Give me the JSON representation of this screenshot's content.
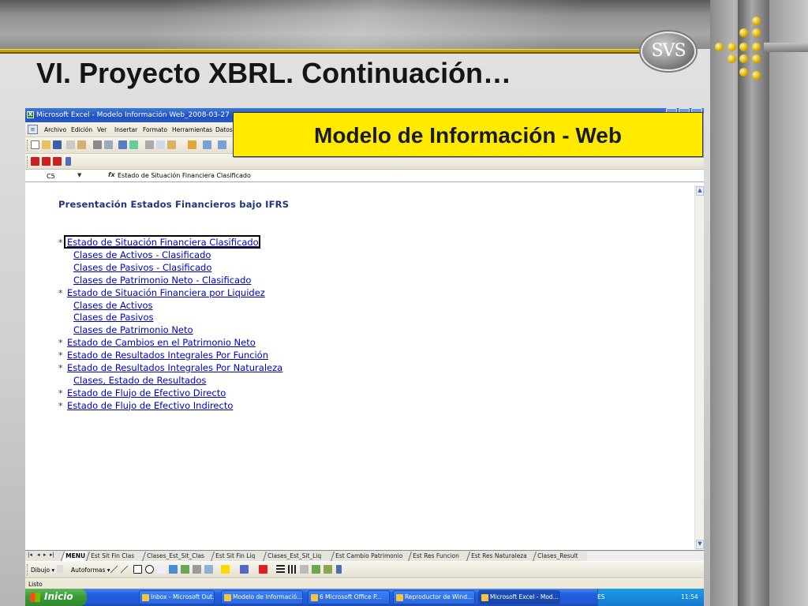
{
  "slide": {
    "title": "VI. Proyecto XBRL. Continuación…",
    "logo_text": "SVS",
    "callout_text": "Modelo de Información - Web"
  },
  "excel": {
    "window_title": "Microsoft Excel - Modelo Información Web_2008-03-27",
    "menu": [
      "Archivo",
      "Edición",
      "Ver",
      "Insertar",
      "Formato",
      "Herramientas",
      "Datos"
    ],
    "name_box": "C5",
    "fx_label": "fx",
    "formula": "Estado de Situación Financiera Clasificado",
    "sheet": {
      "heading": "Presentación Estados Financieros bajo IFRS",
      "items": [
        {
          "label": "Estado de Situación Financiera Clasificado",
          "level": 0,
          "star": "*"
        },
        {
          "label": "Clases de Activos - Clasificado",
          "level": 1
        },
        {
          "label": "Clases de Pasivos - Clasificado",
          "level": 1
        },
        {
          "label": "Clases de Patrimonio Neto - Clasificado",
          "level": 1
        },
        {
          "label": "Estado de Situación Financiera por Liquidez",
          "level": 0,
          "star": "*"
        },
        {
          "label": "Clases de Activos",
          "level": 1
        },
        {
          "label": "Clases de Pasivos",
          "level": 1
        },
        {
          "label": "Clases de Patrimonio Neto",
          "level": 1
        },
        {
          "label": "Estado de Cambios en el Patrimonio Neto",
          "level": 0,
          "star": "*"
        },
        {
          "label": "Estado de Resultados Integrales Por Función",
          "level": 0,
          "star": "*"
        },
        {
          "label": "Estado de Resultados Integrales Por Naturaleza",
          "level": 0,
          "star": "*"
        },
        {
          "label": "Clases, Estado de Resultados",
          "level": 1
        },
        {
          "label": "Estado de Flujo de Efectivo Directo",
          "level": 0,
          "star": "*"
        },
        {
          "label": "Estado de Flujo de Efectivo Indirecto",
          "level": 0,
          "star": "*"
        }
      ]
    },
    "tabs": [
      "MENU",
      "Est Sit Fin Clas",
      "Clases_Est_Sit_Clas",
      "Est Sit Fin Liq",
      "Clases_Est_Sit_Liq",
      "Est Cambio Patrimonio",
      "Est Res Funcion",
      "Est Res Naturaleza",
      "Clases_Result"
    ],
    "draw_toolbar": {
      "dibujo": "Dibujo ▾",
      "autoformas": "Autoformas ▾"
    },
    "status": "Listo"
  },
  "taskbar": {
    "start": "Inicio",
    "tasks": [
      {
        "label": "Inbox - Microsoft Out..."
      },
      {
        "label": "Modelo de Informació..."
      },
      {
        "label": "6 Microsoft Office P..."
      },
      {
        "label": "Reproductor de Wind..."
      },
      {
        "label": "Microsoft Excel - Mod..."
      }
    ],
    "lang": "ES",
    "clock": "11:54"
  },
  "colors": {
    "accent_gold": "#c9a200",
    "callout_yellow": "#ffea00",
    "link_blue": "#0000cc",
    "heading_blue": "#1f3580"
  }
}
